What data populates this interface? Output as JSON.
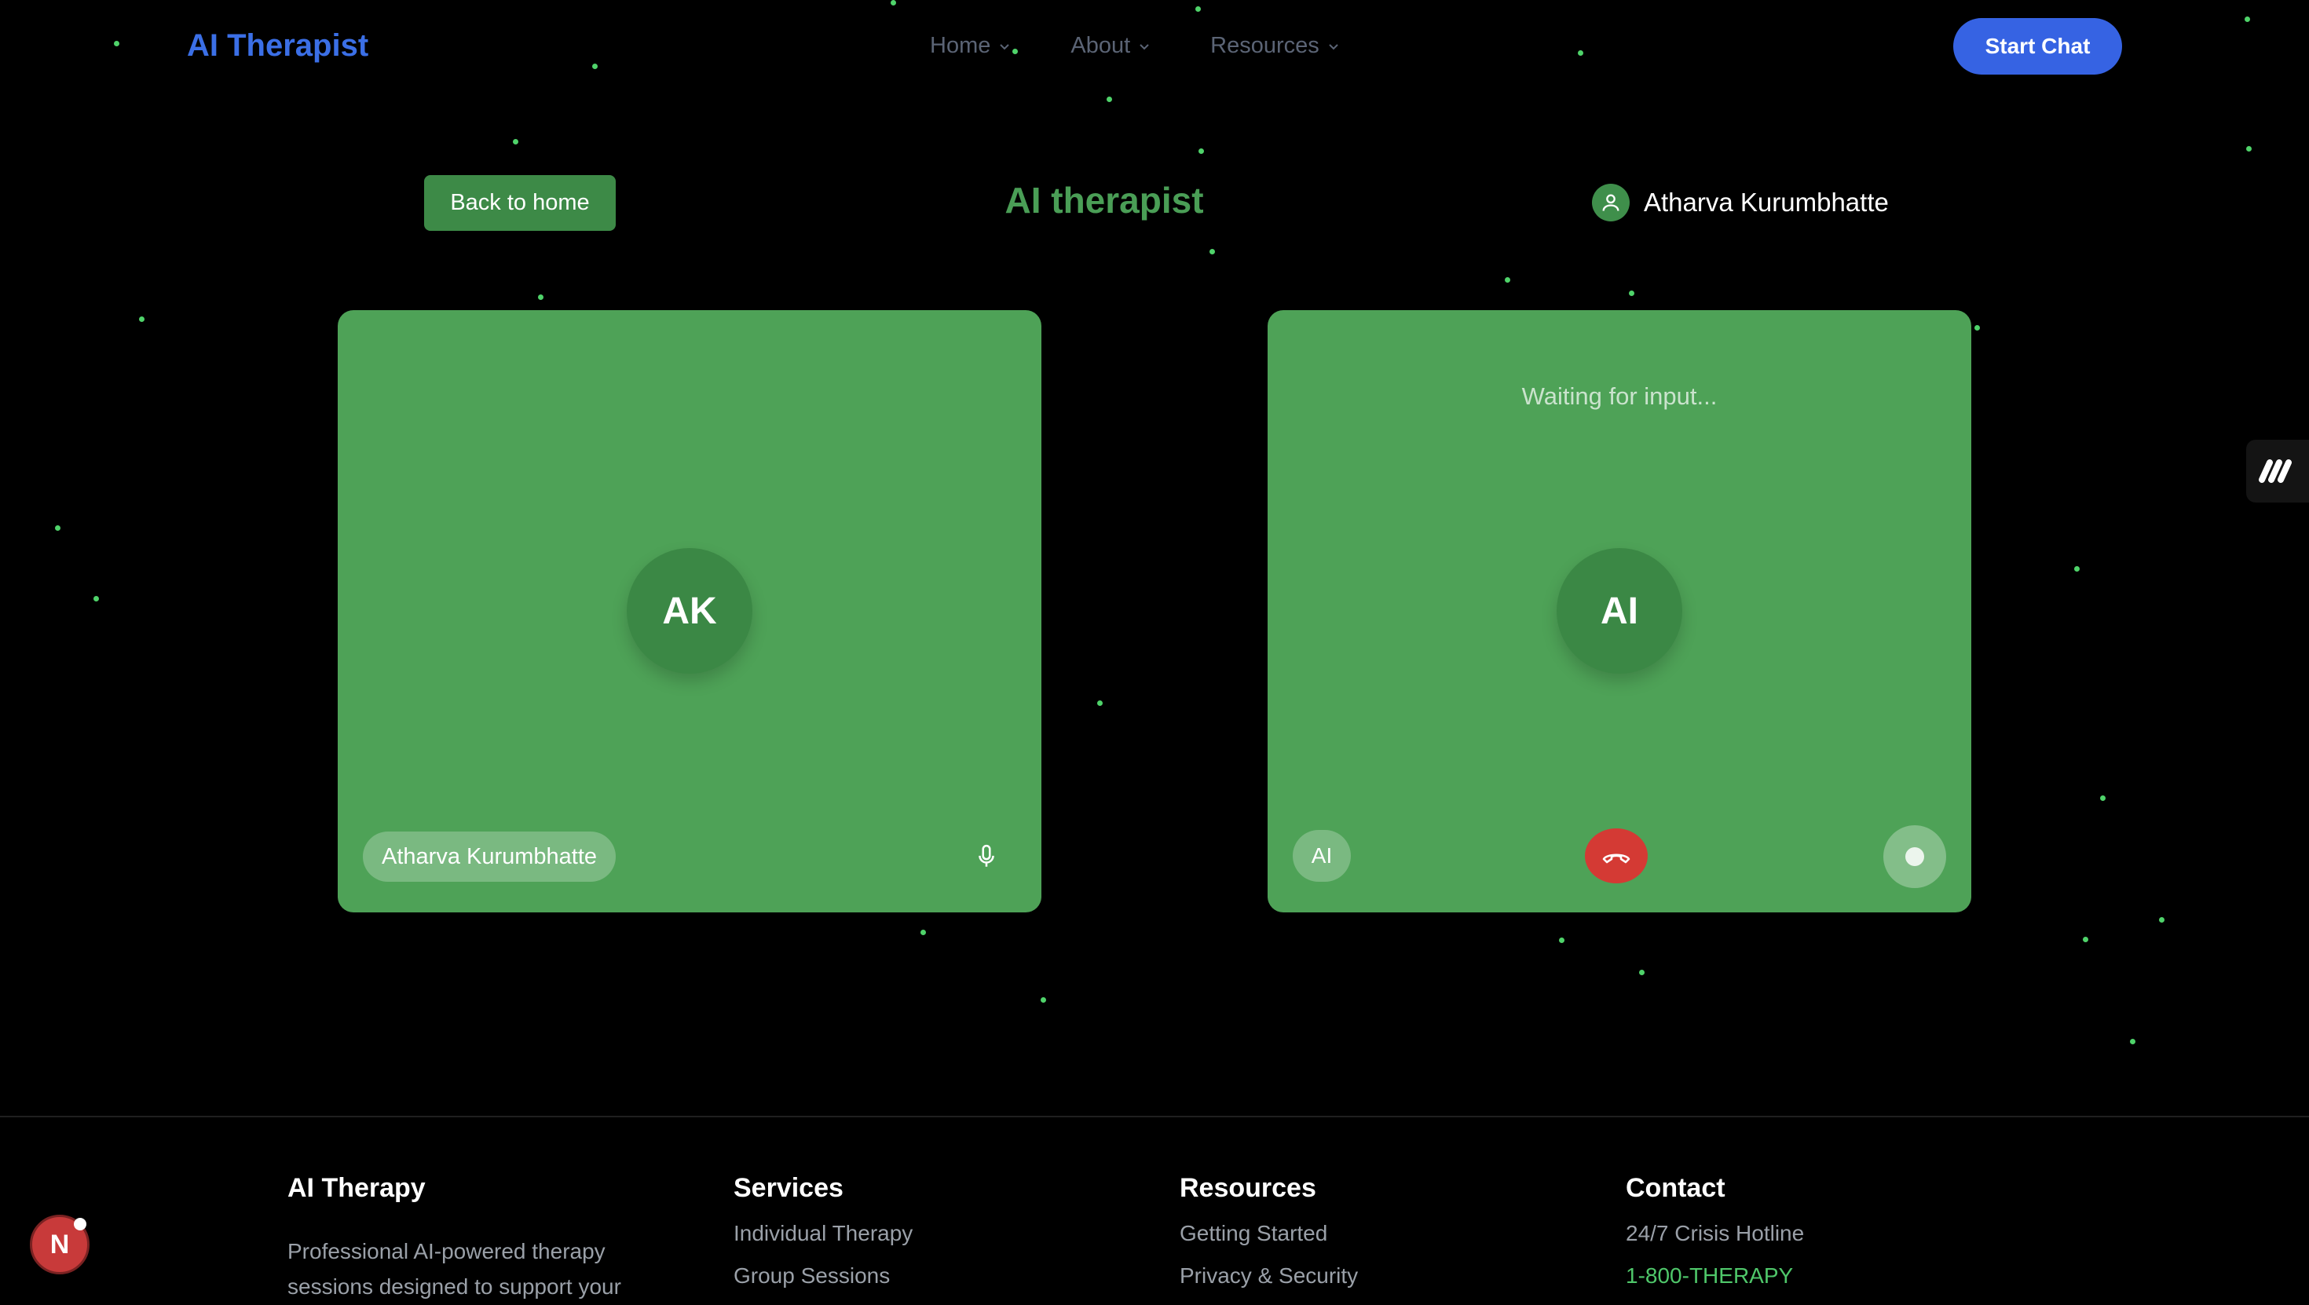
{
  "nav": {
    "brand": "AI Therapist",
    "items": [
      {
        "label": "Home"
      },
      {
        "label": "About"
      },
      {
        "label": "Resources"
      }
    ],
    "cta": "Start Chat"
  },
  "header": {
    "back_label": "Back to home",
    "title": "AI therapist",
    "user_name": "Atharva Kurumbhatte"
  },
  "user_panel": {
    "initials": "AK",
    "name": "Atharva Kurumbhatte"
  },
  "ai_panel": {
    "status": "Waiting for input...",
    "initials": "AI",
    "badge": "AI"
  },
  "footer": {
    "brand": {
      "title": "AI Therapy",
      "desc": "Professional AI-powered therapy sessions designed to support your"
    },
    "services": {
      "title": "Services",
      "links": [
        "Individual Therapy",
        "Group Sessions"
      ]
    },
    "resources": {
      "title": "Resources",
      "links": [
        "Getting Started",
        "Privacy & Security"
      ]
    },
    "contact": {
      "title": "Contact",
      "hotline_label": "24/7 Crisis Hotline",
      "hotline_number": "1-800-THERAPY"
    }
  },
  "dev_badge": "N",
  "colors": {
    "background": "#000000",
    "brand": "#3b6fe6",
    "panel": "#4ea257",
    "accent_green": "#4a9e56",
    "hangup": "#d43a34",
    "cta": "#3663e3"
  }
}
